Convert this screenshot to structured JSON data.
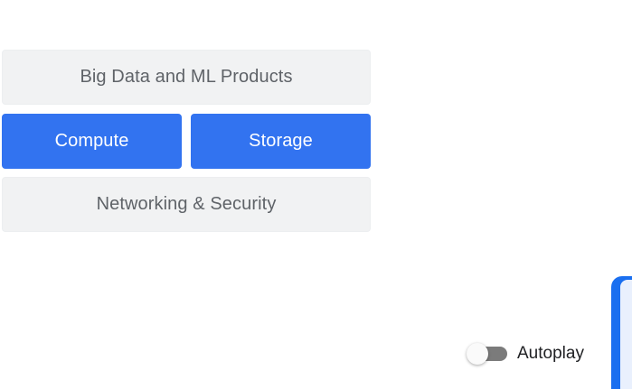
{
  "tiles": {
    "big_data": "Big Data and ML Products",
    "compute": "Compute",
    "storage": "Storage",
    "networking": "Networking & Security"
  },
  "autoplay": {
    "label": "Autoplay",
    "enabled": false
  },
  "colors": {
    "accent_blue": "#3273f0",
    "tile_gray": "#f1f2f3",
    "tile_gray_text": "#5f6368",
    "toggle_track": "#7b7b7b",
    "edge_panel_blue": "#1a6ff0",
    "logo_segments": [
      "#fbbc04",
      "#4285f4",
      "#4285f4"
    ]
  }
}
